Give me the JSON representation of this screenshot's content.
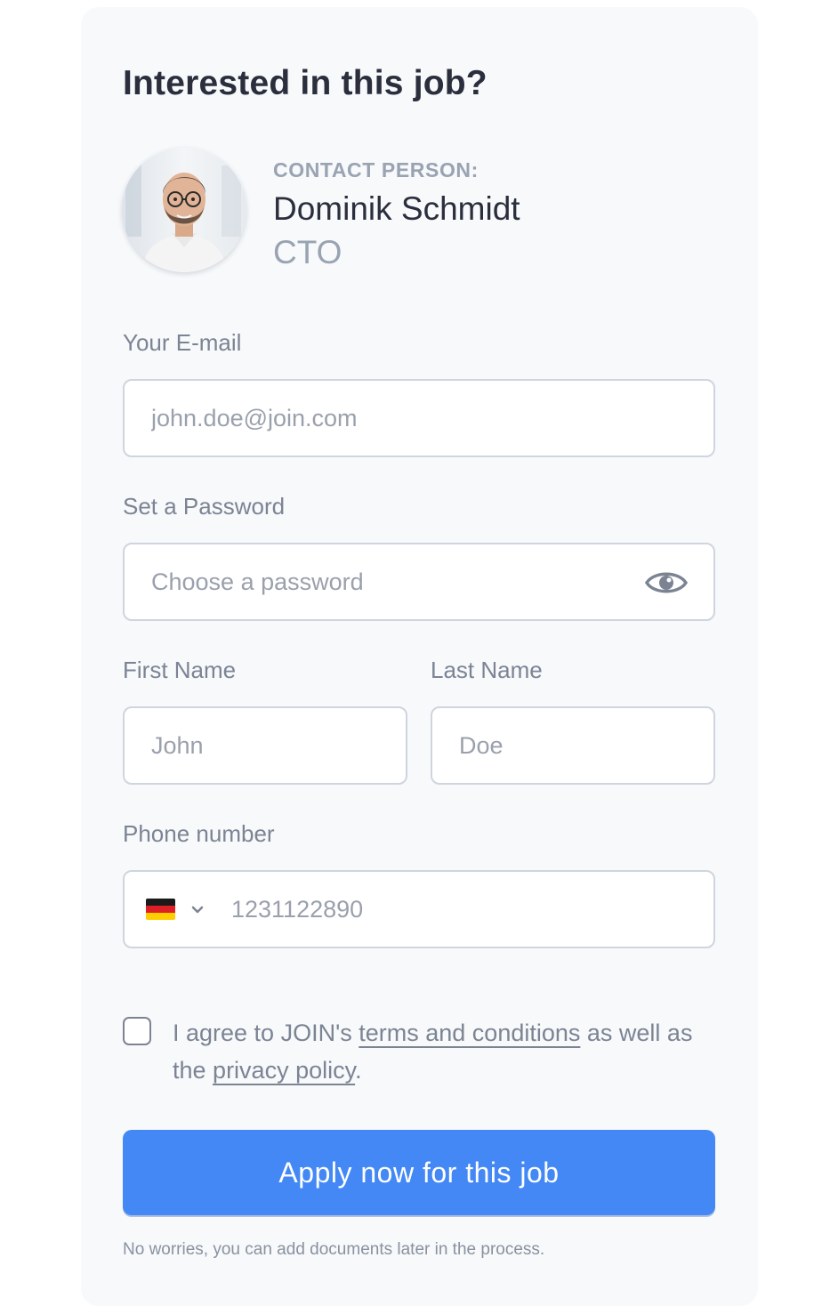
{
  "heading": "Interested in this job?",
  "contact": {
    "label": "CONTACT PERSON:",
    "name": "Dominik Schmidt",
    "role": "CTO"
  },
  "form": {
    "email": {
      "label": "Your E-mail",
      "placeholder": "john.doe@join.com",
      "value": ""
    },
    "password": {
      "label": "Set a Password",
      "placeholder": "Choose a password",
      "value": ""
    },
    "first_name": {
      "label": "First Name",
      "placeholder": "John",
      "value": ""
    },
    "last_name": {
      "label": "Last Name",
      "placeholder": "Doe",
      "value": ""
    },
    "phone": {
      "label": "Phone number",
      "placeholder": "1231122890",
      "value": "",
      "country_flag": "germany-flag-icon"
    },
    "agree": {
      "checked": false,
      "text_before": "I agree to JOIN's ",
      "terms_link": "terms and conditions",
      "text_middle": " as well as the ",
      "privacy_link": "privacy policy",
      "text_after": "."
    },
    "submit_label": "Apply now for this job",
    "footnote": "No worries, you can add documents later in the process."
  },
  "colors": {
    "accent": "#4388f4",
    "card_bg": "#f7f9fb",
    "heading_text": "#2b2f3d",
    "muted_text": "#7c8494"
  },
  "icons": [
    "avatar-photo",
    "eye-icon",
    "germany-flag-icon",
    "chevron-down-icon"
  ]
}
